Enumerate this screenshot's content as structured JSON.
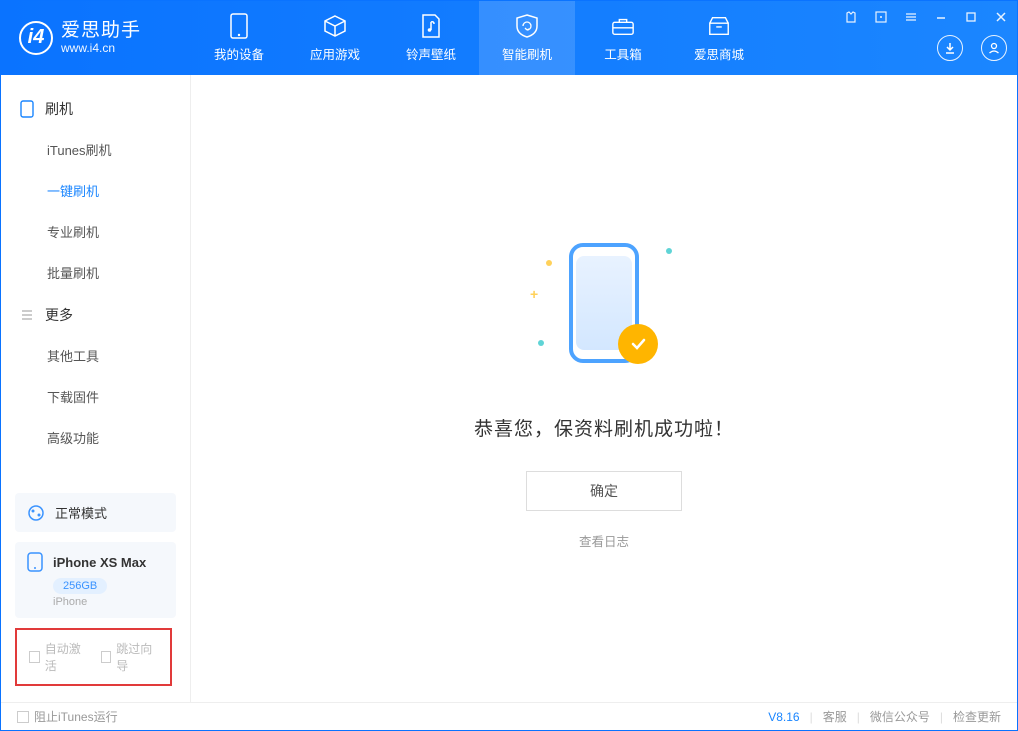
{
  "app": {
    "name_cn": "爱思助手",
    "url": "www.i4.cn"
  },
  "tabs": [
    {
      "label": "我的设备",
      "icon": "phone"
    },
    {
      "label": "应用游戏",
      "icon": "cube"
    },
    {
      "label": "铃声壁纸",
      "icon": "music"
    },
    {
      "label": "智能刷机",
      "icon": "refresh"
    },
    {
      "label": "工具箱",
      "icon": "toolbox"
    },
    {
      "label": "爱思商城",
      "icon": "home"
    }
  ],
  "active_tab": 3,
  "sidebar": {
    "section1": {
      "title": "刷机",
      "items": [
        "iTunes刷机",
        "一键刷机",
        "专业刷机",
        "批量刷机"
      ],
      "active": 1
    },
    "section2": {
      "title": "更多",
      "items": [
        "其他工具",
        "下载固件",
        "高级功能"
      ]
    },
    "mode_label": "正常模式",
    "device": {
      "name": "iPhone XS Max",
      "storage": "256GB",
      "type": "iPhone"
    },
    "checkboxes": {
      "auto_activate": "自动激活",
      "skip_guide": "跳过向导"
    }
  },
  "main": {
    "success_message": "恭喜您，保资料刷机成功啦！",
    "confirm_label": "确定",
    "view_log_label": "查看日志"
  },
  "footer": {
    "block_itunes": "阻止iTunes运行",
    "version": "V8.16",
    "links": [
      "客服",
      "微信公众号",
      "检查更新"
    ]
  }
}
